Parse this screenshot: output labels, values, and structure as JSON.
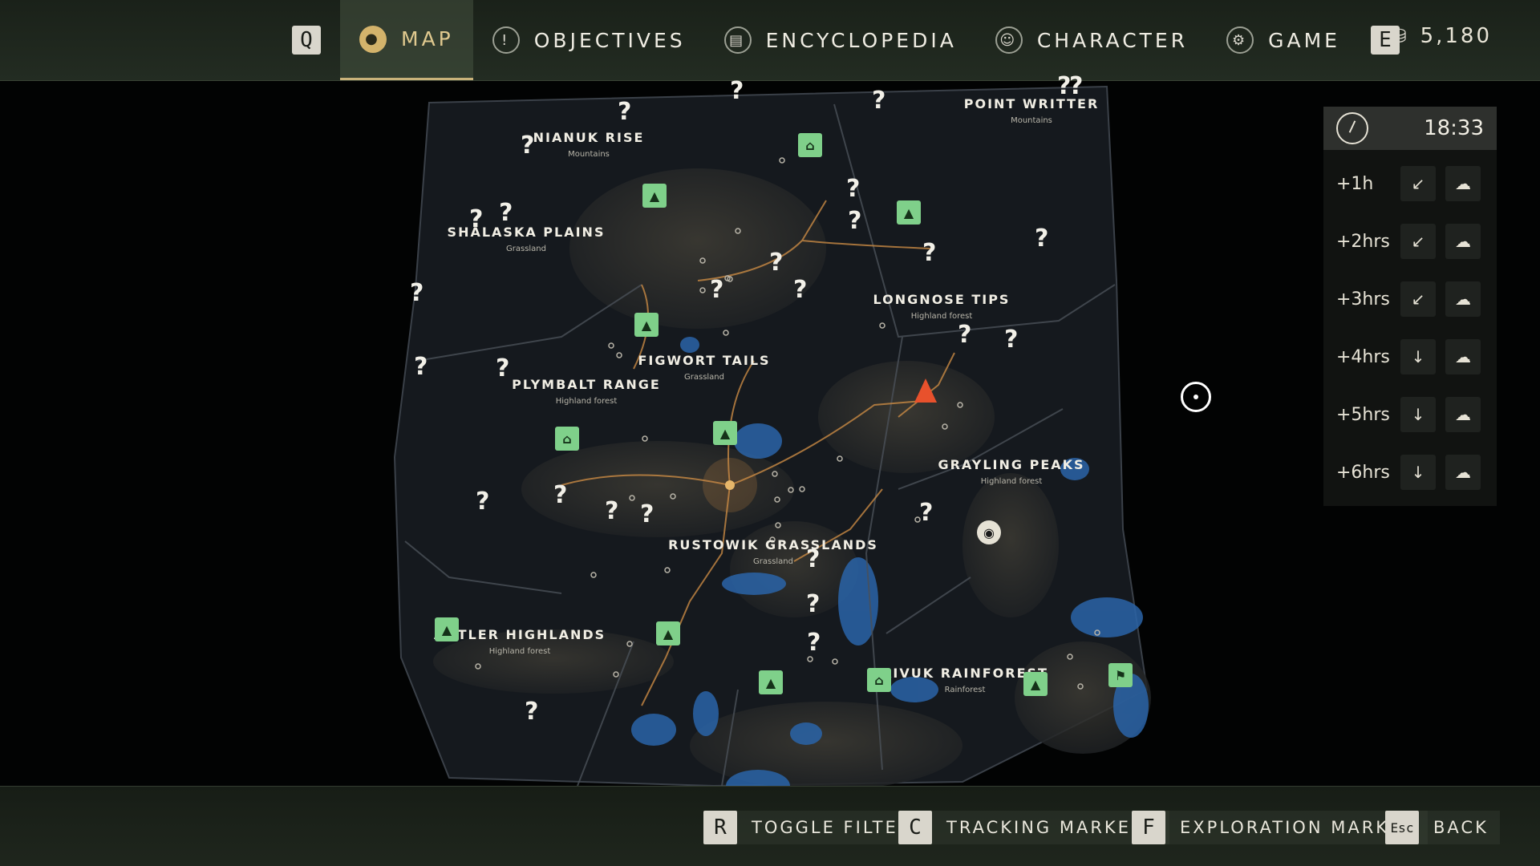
{
  "nav": {
    "left_key": "Q",
    "right_key": "E",
    "tabs": [
      {
        "label": "MAP",
        "icon": "map-pin-icon",
        "active": true
      },
      {
        "label": "OBJECTIVES",
        "icon": "exclamation-icon",
        "active": false
      },
      {
        "label": "ENCYCLOPEDIA",
        "icon": "book-icon",
        "active": false
      },
      {
        "label": "CHARACTER",
        "icon": "person-icon",
        "active": false
      },
      {
        "label": "GAME",
        "icon": "gear-icon",
        "active": false
      }
    ],
    "money": "5,180"
  },
  "weather": {
    "time": "18:33",
    "forecast": [
      {
        "label": "+1h"
      },
      {
        "label": "+2hrs"
      },
      {
        "label": "+3hrs"
      },
      {
        "label": "+4hrs"
      },
      {
        "label": "+5hrs"
      },
      {
        "label": "+6hrs"
      }
    ]
  },
  "regions": [
    {
      "name": "NIANUK RISE",
      "biome": "Mountains"
    },
    {
      "name": "POINT WRITTER",
      "biome": "Mountains"
    },
    {
      "name": "SHALASKA PLAINS",
      "biome": "Grassland"
    },
    {
      "name": "LONGNOSE TIPS",
      "biome": "Highland forest"
    },
    {
      "name": "FIGWORT TAILS",
      "biome": "Grassland"
    },
    {
      "name": "PLYMBALT RANGE",
      "biome": "Highland forest"
    },
    {
      "name": "GRAYLING PEAKS",
      "biome": "Highland forest"
    },
    {
      "name": "RUSTOWIK GRASSLANDS",
      "biome": "Grassland"
    },
    {
      "name": "ANTLER HIGHLANDS",
      "biome": "Highland forest"
    },
    {
      "name": "AIVUK RAINFOREST",
      "biome": "Rainforest"
    }
  ],
  "unknown_marker": "?",
  "hints": [
    {
      "key": "R",
      "label": "TOGGLE FILTER"
    },
    {
      "key": "C",
      "label": "TRACKING MARKERS"
    },
    {
      "key": "F",
      "label": "EXPLORATION MARKER"
    },
    {
      "key": "Esc",
      "label": "BACK"
    }
  ],
  "colors": {
    "accent": "#d3b36b",
    "camp": "#7fd08a",
    "player": "#e8512c",
    "water": "#2a64a8"
  }
}
